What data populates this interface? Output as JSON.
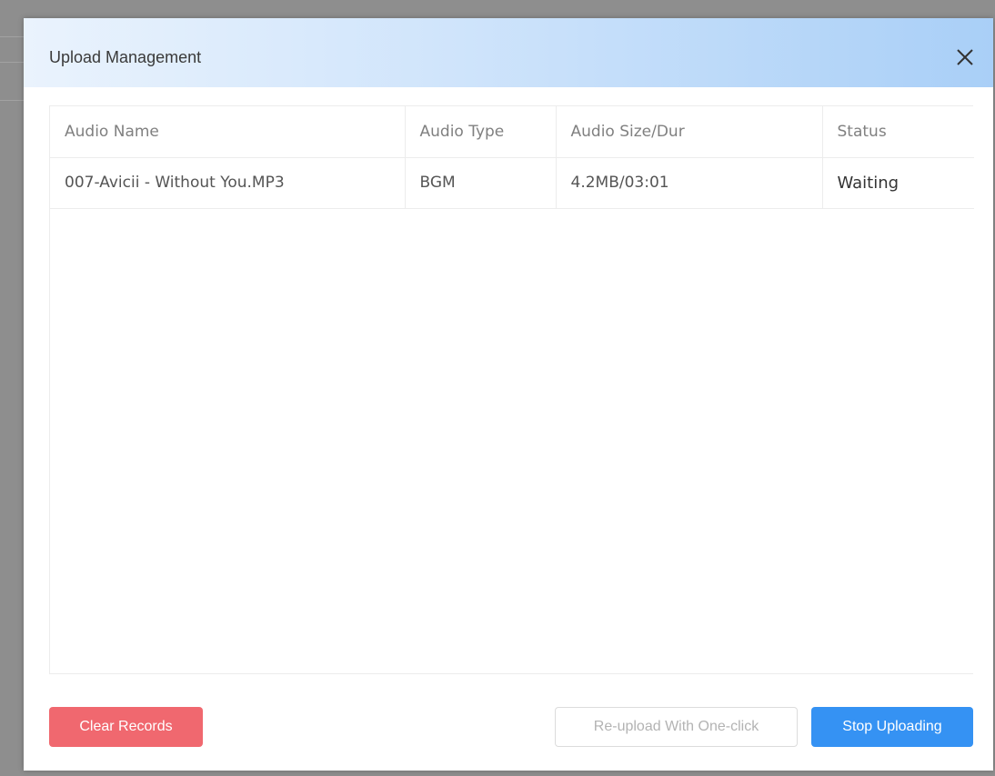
{
  "modal": {
    "title": "Upload Management",
    "close_icon": "close-icon"
  },
  "table": {
    "columns": [
      "Audio Name",
      "Audio Type",
      "Audio Size/Dur",
      "Status"
    ],
    "rows": [
      {
        "name": "007-Avicii - Without You.MP3",
        "type": "BGM",
        "size_dur": "4.2MB/03:01",
        "status": "Waiting"
      }
    ]
  },
  "footer": {
    "clear_label": "Clear Records",
    "reupload_label": "Re-upload With One-click",
    "stop_label": "Stop Uploading"
  },
  "colors": {
    "clear_button": "#f0686f",
    "stop_button": "#3592f3",
    "header_gradient_end": "#a9cff7"
  }
}
